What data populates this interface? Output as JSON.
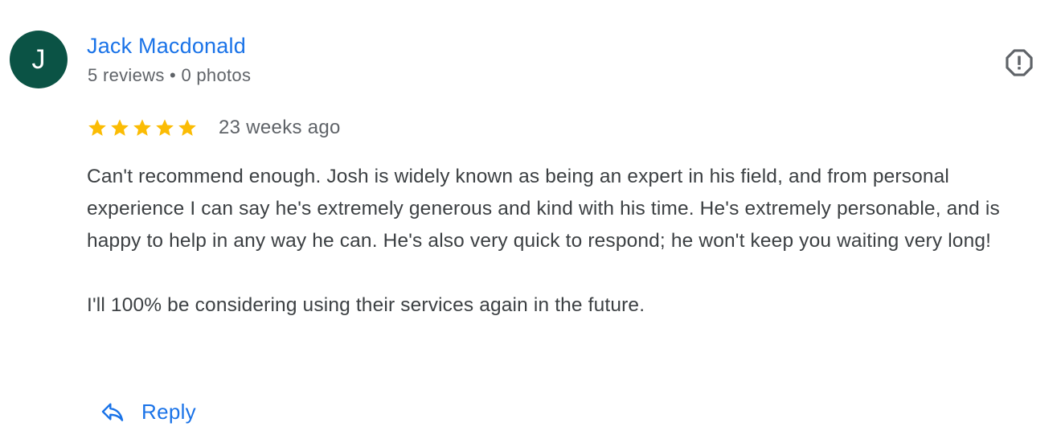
{
  "reviewer": {
    "initial": "J",
    "avatar_color": "#0b5345",
    "name": "Jack Macdonald",
    "meta": "5 reviews • 0 photos"
  },
  "report": {
    "icon": "report-octagon-icon"
  },
  "rating": {
    "stars": 5,
    "max_stars": 5,
    "star_color": "#fbbc04",
    "time_ago": "23 weeks ago"
  },
  "review": {
    "paragraphs": [
      "Can't recommend enough. Josh is widely known as being an expert in his field, and from personal experience I can say he's extremely generous and kind with his time. He's extremely personable, and is happy to help in any way he can. He's also very quick to respond; he won't keep you waiting very long!",
      "I'll 100% be considering using their services again in the future."
    ]
  },
  "actions": {
    "reply_label": "Reply",
    "reply_icon": "reply-arrow-icon"
  },
  "colors": {
    "link": "#1a73e8",
    "secondary_text": "#5f6368",
    "body_text": "#3c4043"
  }
}
